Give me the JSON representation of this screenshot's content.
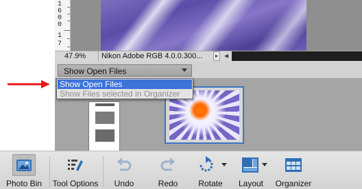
{
  "ruler": {
    "digits": [
      "1",
      "6",
      "0",
      "0",
      "1",
      "7"
    ]
  },
  "status_bar": {
    "zoom": "47.9%",
    "profile": "Nikon Adobe RGB 4.0.0.300..."
  },
  "bin": {
    "selected_label": "Show Open Files",
    "options": [
      "Show Open Files",
      "Show Files selected in Organizer"
    ]
  },
  "toolbar": {
    "items": [
      {
        "label": "Photo Bin",
        "icon": "photo-bin-icon"
      },
      {
        "label": "Tool Options",
        "icon": "tool-options-icon"
      },
      {
        "label": "Undo",
        "icon": "undo-icon"
      },
      {
        "label": "Redo",
        "icon": "redo-icon"
      },
      {
        "label": "Rotate",
        "icon": "rotate-icon"
      },
      {
        "label": "Layout",
        "icon": "layout-icon"
      },
      {
        "label": "Organizer",
        "icon": "organizer-icon"
      }
    ]
  },
  "colors": {
    "accent_blue": "#3b73d9",
    "annotation_red": "#e8161b",
    "toolbar_icon_blue": "#2f6fb5"
  }
}
